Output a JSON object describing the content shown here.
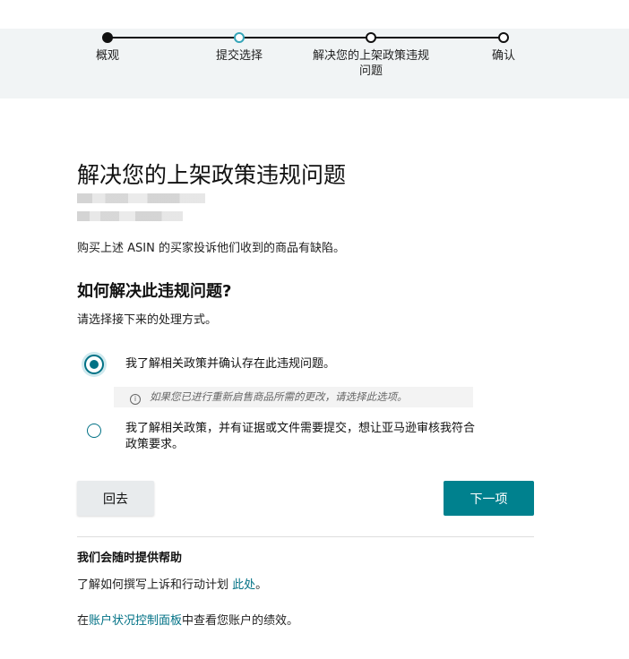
{
  "stepper": {
    "steps": [
      {
        "label": "概观",
        "state": "complete"
      },
      {
        "label": "提交选择",
        "state": "current"
      },
      {
        "label": "解决您的上架政策违规\n问题",
        "state": "upcoming"
      },
      {
        "label": "确认",
        "state": "upcoming"
      }
    ],
    "colors": {
      "complete": "#111111",
      "current": "#35a5b8",
      "upcoming": "#111111"
    }
  },
  "main": {
    "title": "解决您的上架政策违规问题",
    "description": "购买上述 ASIN 的买家投诉他们收到的商品有缺陷。",
    "question_heading": "如何解决此违规问题?",
    "question_sub": "请选择接下来的处理方式。",
    "options": [
      {
        "label": "我了解相关政策并确认存在此违规问题。",
        "selected": true
      },
      {
        "label": "我了解相关政策，并有证据或文件需要提交，想让亚马逊审核我符合\n政策要求。",
        "selected": false
      }
    ],
    "hint": "如果您已进行重新启售商品所需的更改，请选择此选项。"
  },
  "buttons": {
    "back_label": "回去",
    "next_label": "下一项"
  },
  "help": {
    "title": "我们会随时提供帮助",
    "line1_prefix": "了解如何撰写上诉和行动计划 ",
    "line1_link": "此处",
    "line1_suffix": "。",
    "line2_prefix": "在",
    "line2_link": "账户状况控制面板",
    "line2_suffix": "中查看您账户的绩效。"
  },
  "colors": {
    "accent": "#007185",
    "primary_button": "#00818e",
    "band_background": "#f1f4f5"
  }
}
